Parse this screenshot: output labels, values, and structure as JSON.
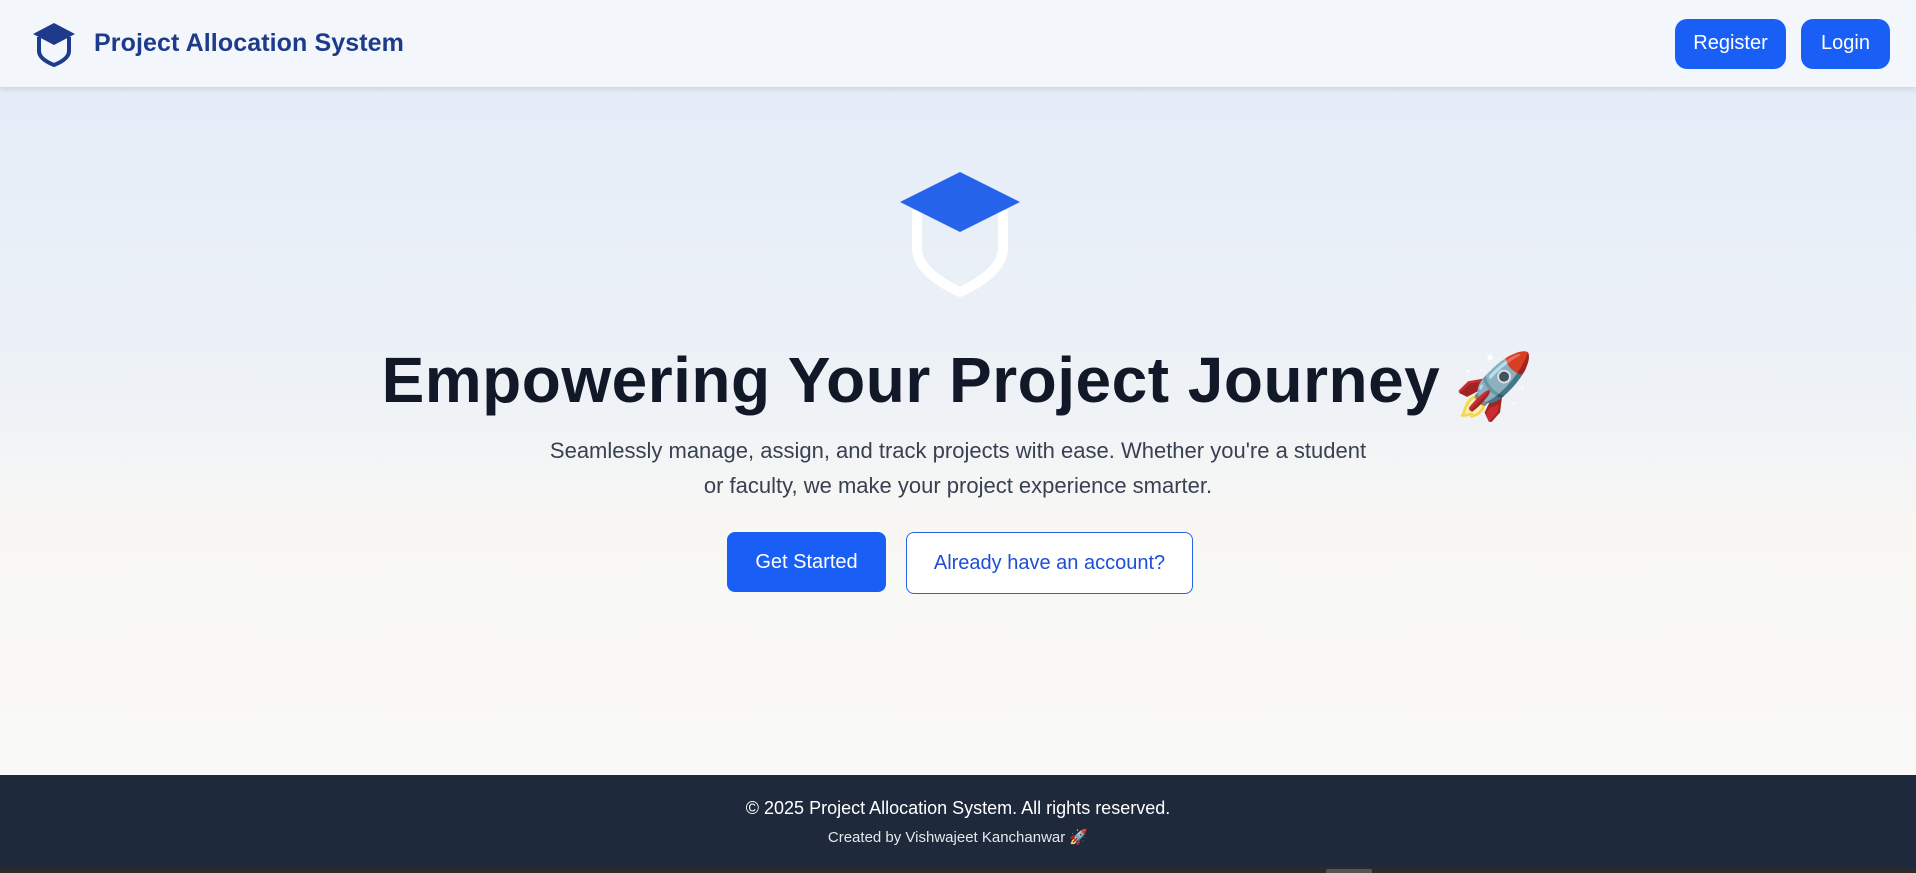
{
  "navbar": {
    "logo_icon": "graduation-cap-shield-icon",
    "title": "Project Allocation System",
    "register_label": "Register",
    "login_label": "Login"
  },
  "hero": {
    "icon": "graduation-cap-shield-icon",
    "title": "Empowering Your Project Journey",
    "title_emoji": "🚀",
    "subtitle": "Seamlessly manage, assign, and track projects with ease. Whether you're a student or faculty, we make your project experience smarter.",
    "get_started_label": "Get Started",
    "have_account_label": "Already have an account?"
  },
  "footer": {
    "copyright": "© 2025 Project Allocation System. All rights reserved.",
    "credit": "Created by Vishwajeet Kanchanwar 🚀"
  },
  "colors": {
    "brand": "#1e3a8a",
    "accent": "#1a5ff5",
    "footer_bg": "#1e293b",
    "hero_icon": "#2563eb"
  }
}
